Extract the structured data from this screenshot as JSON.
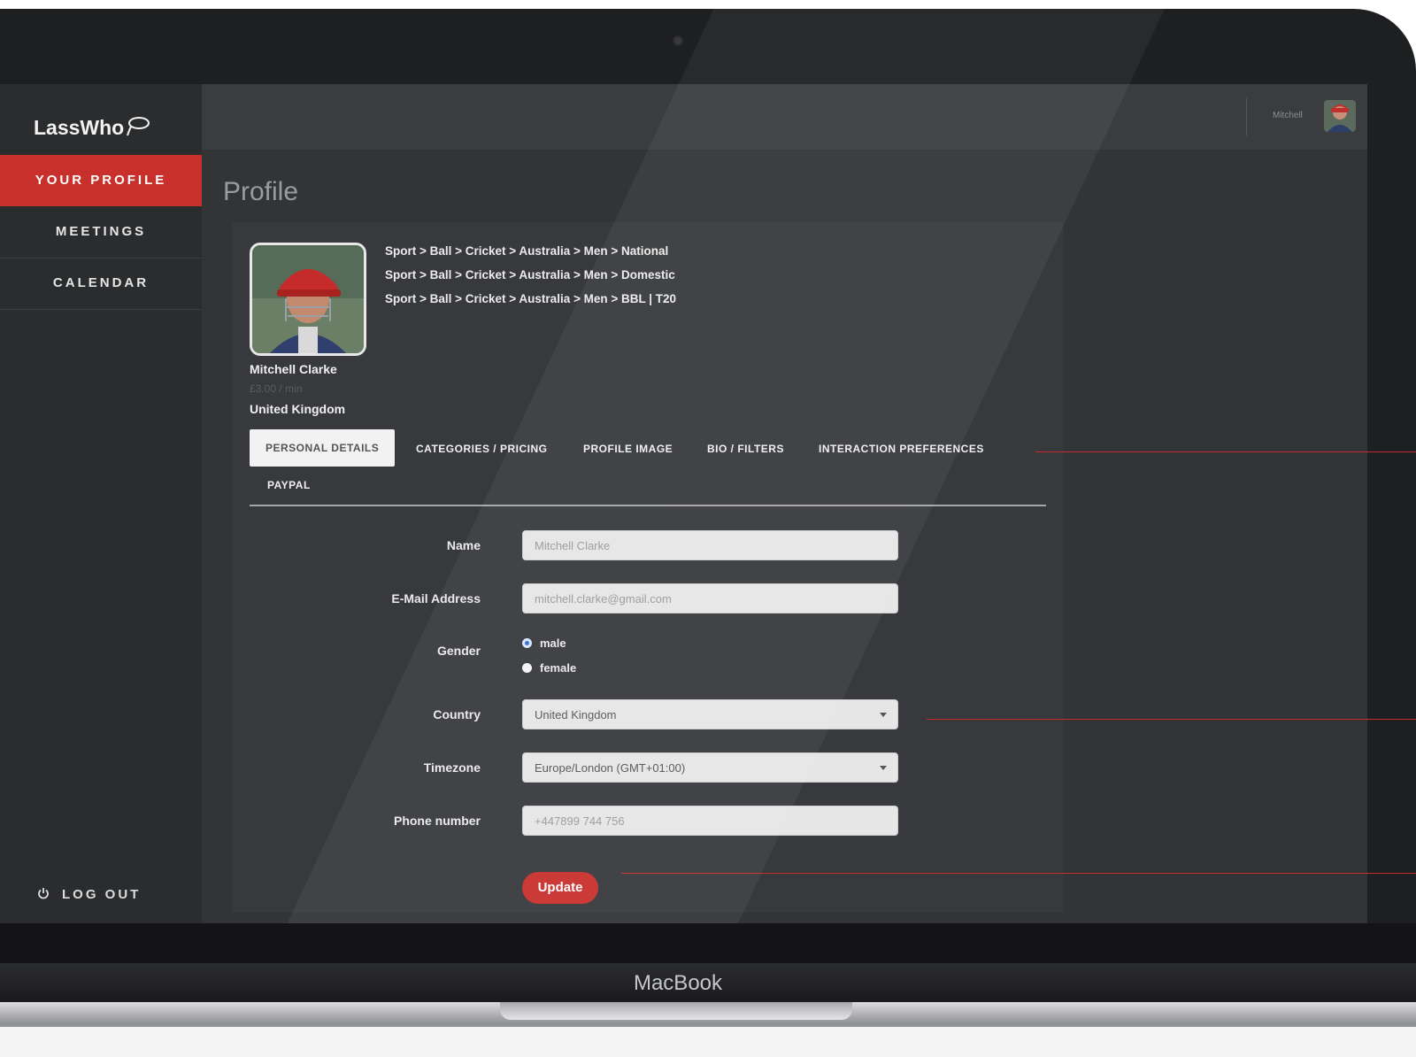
{
  "app": {
    "brand": "LassWho"
  },
  "device": {
    "label": "MacBook"
  },
  "sidebar": {
    "items": [
      {
        "label": "YOUR PROFILE",
        "active": true
      },
      {
        "label": "MEETINGS",
        "active": false
      },
      {
        "label": "CALENDAR",
        "active": false
      }
    ],
    "logout_label": "LOG OUT"
  },
  "header": {
    "username": "Mitchell",
    "avatar_icon": "user-avatar"
  },
  "page": {
    "title": "Profile"
  },
  "profile": {
    "name": "Mitchell Clarke",
    "price": "£3.00 / min",
    "country": "United Kingdom",
    "categories": [
      "Sport > Ball > Cricket > Australia > Men > National",
      "Sport > Ball > Cricket > Australia > Men > Domestic",
      "Sport > Ball > Cricket > Australia > Men > BBL | T20"
    ]
  },
  "tabs": [
    {
      "label": "PERSONAL DETAILS",
      "active": true
    },
    {
      "label": "CATEGORIES / PRICING",
      "active": false
    },
    {
      "label": "PROFILE IMAGE",
      "active": false
    },
    {
      "label": "BIO / FILTERS",
      "active": false
    },
    {
      "label": "INTERACTION PREFERENCES",
      "active": false
    },
    {
      "label": "PAYPAL",
      "active": false
    }
  ],
  "form": {
    "name_label": "Name",
    "name_value": "Mitchell Clarke",
    "email_label": "E-Mail Address",
    "email_value": "mitchell.clarke@gmail.com",
    "gender_label": "Gender",
    "gender_options": [
      "male",
      "female"
    ],
    "gender_selected": "male",
    "country_label": "Country",
    "country_value": "United Kingdom",
    "timezone_label": "Timezone",
    "timezone_value": "Europe/London (GMT+01:00)",
    "phone_label": "Phone number",
    "phone_value": "+447899 744 756",
    "submit_label": "Update"
  },
  "colors": {
    "accent": "#c9302c",
    "sidebar_bg": "#2b2c2e",
    "screen_bg": "#333436",
    "card_bg": "#38393c"
  }
}
